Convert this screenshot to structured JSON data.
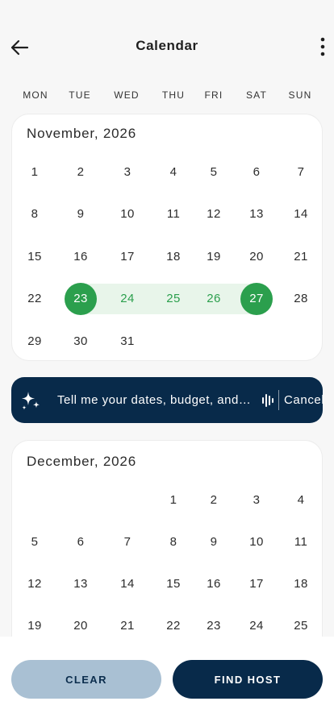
{
  "header": {
    "title": "Calendar"
  },
  "weekdays": [
    "MON",
    "TUE",
    "WED",
    "THU",
    "FRI",
    "SAT",
    "SUN"
  ],
  "months": [
    {
      "title": "November, 2026",
      "weeks": [
        [
          "1",
          "2",
          "3",
          "4",
          "5",
          "6",
          "7"
        ],
        [
          "8",
          "9",
          "10",
          "11",
          "12",
          "13",
          "14"
        ],
        [
          "15",
          "16",
          "17",
          "18",
          "19",
          "20",
          "21"
        ],
        [
          "22",
          "23",
          "24",
          "25",
          "26",
          "27",
          "28"
        ],
        [
          "29",
          "30",
          "31",
          "",
          "",
          "",
          ""
        ]
      ],
      "selected_start": "23",
      "selected_end": "27",
      "in_range": [
        "24",
        "25",
        "26"
      ]
    },
    {
      "title": "December, 2026",
      "weeks": [
        [
          "",
          "",
          "",
          "1",
          "2",
          "3",
          "4"
        ],
        [
          "5",
          "6",
          "7",
          "8",
          "9",
          "10",
          "11"
        ],
        [
          "12",
          "13",
          "14",
          "15",
          "16",
          "17",
          "18"
        ],
        [
          "19",
          "20",
          "21",
          "22",
          "23",
          "24",
          "25"
        ]
      ]
    }
  ],
  "assistant": {
    "prompt": "Tell me your dates, budget, and…",
    "cancel_label": "Cancel"
  },
  "actions": {
    "clear_label": "CLEAR",
    "find_label": "FIND HOST"
  },
  "colors": {
    "accent_green": "#2b9f4d",
    "range_bg": "#e8f5ea",
    "navy": "#082a4a",
    "clear_bg": "#a9c0d3"
  }
}
